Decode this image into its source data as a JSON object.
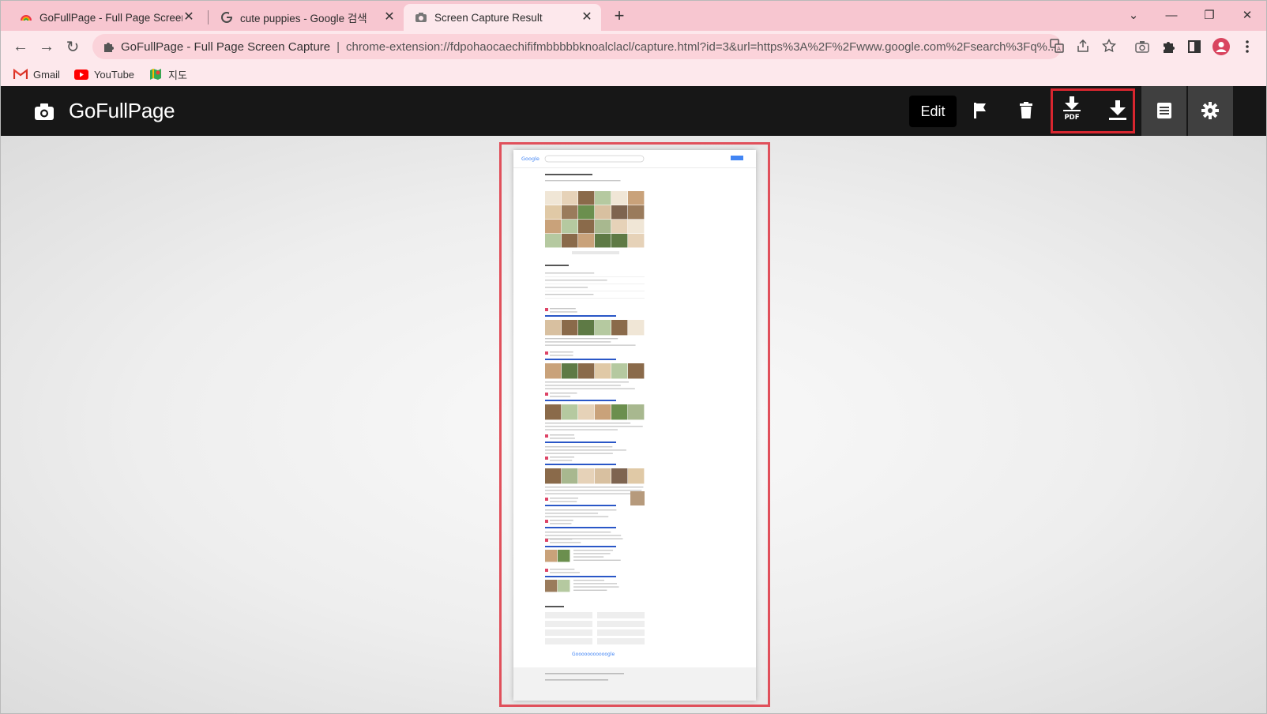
{
  "browser": {
    "tabs": [
      {
        "title": "GoFullPage - Full Page Screen C",
        "favicon": "gofullpage-rainbow-icon",
        "active": false
      },
      {
        "title": "cute puppies - Google 검색",
        "favicon": "google-g-icon",
        "active": false
      },
      {
        "title": "Screen Capture Result",
        "favicon": "camera-icon",
        "active": true
      }
    ],
    "new_tab_label": "+",
    "omnibox": {
      "site_name": "GoFullPage - Full Page Screen Capture",
      "separator": "|",
      "url": "chrome-extension://fdpohaocaechififmbbbbbknoalclacl/capture.html?id=3&url=https%3A%2F%2Fwww.google.com%2Fsearch%3Fq%..."
    },
    "bookmarks": [
      {
        "label": "Gmail",
        "icon": "gmail-icon"
      },
      {
        "label": "YouTube",
        "icon": "youtube-icon"
      },
      {
        "label": "지도",
        "icon": "maps-icon"
      }
    ]
  },
  "app": {
    "title": "GoFullPage",
    "edit_label": "Edit",
    "pdf_label": "PDF",
    "highlight_color": "#d8262f",
    "header_bg": "#171717"
  },
  "capture": {
    "border_color": "#e0505b",
    "google_logo": "Google",
    "footer_logo": "Gooooooooooogle"
  }
}
